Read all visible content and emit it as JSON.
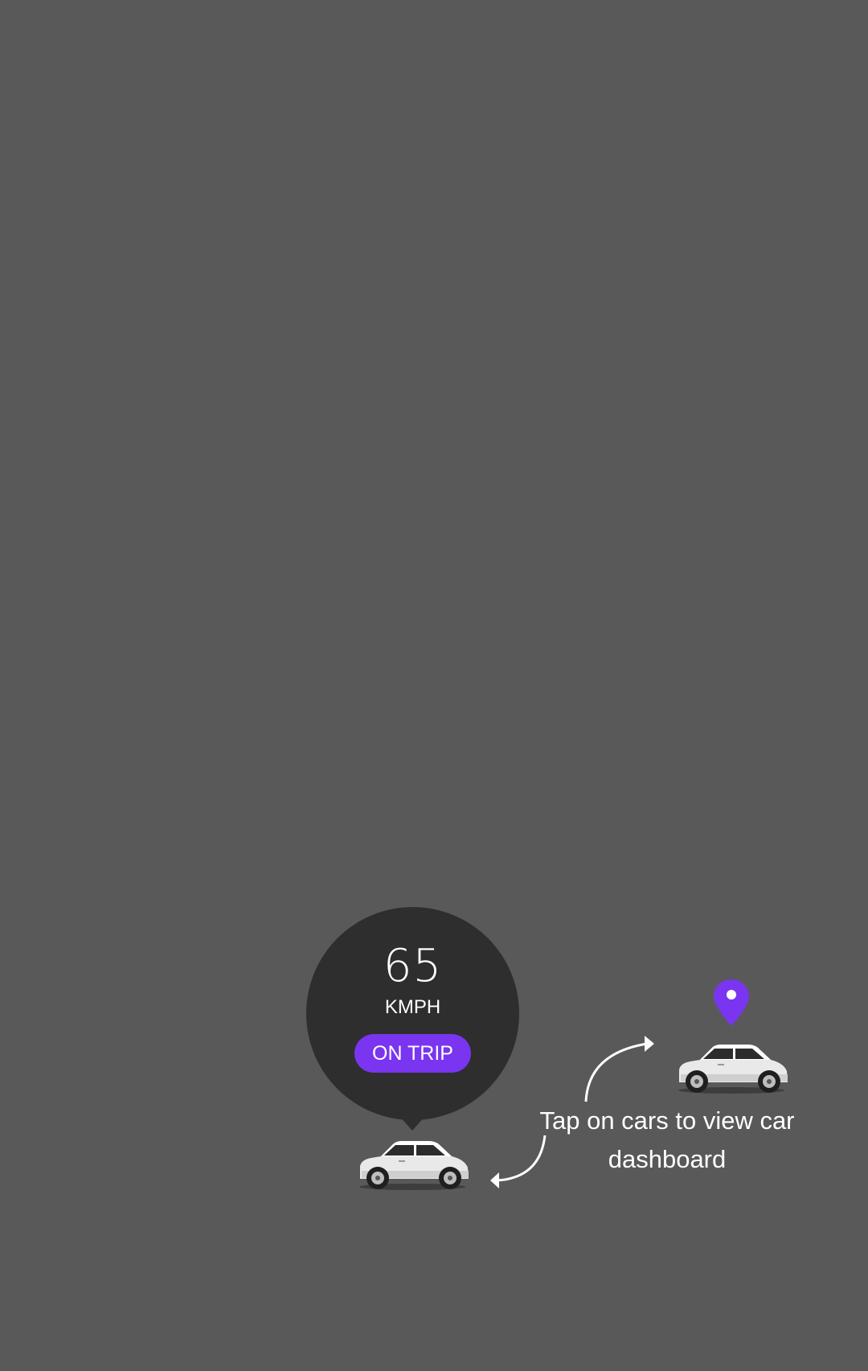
{
  "background_color": "#595959",
  "speed_bubble": {
    "speed_value": "65",
    "speed_unit": "KMPH",
    "status_label": "ON TRIP",
    "bubble_color": "#2e2e2e",
    "status_color": "#7a35f0"
  },
  "markers": {
    "pin_icon": "location-pin-icon",
    "pin_color": "#7a35f0"
  },
  "cars": [
    {
      "icon": "car-icon"
    },
    {
      "icon": "car-icon"
    }
  ],
  "hint": {
    "text": "Tap on cars to view car dashboard"
  }
}
